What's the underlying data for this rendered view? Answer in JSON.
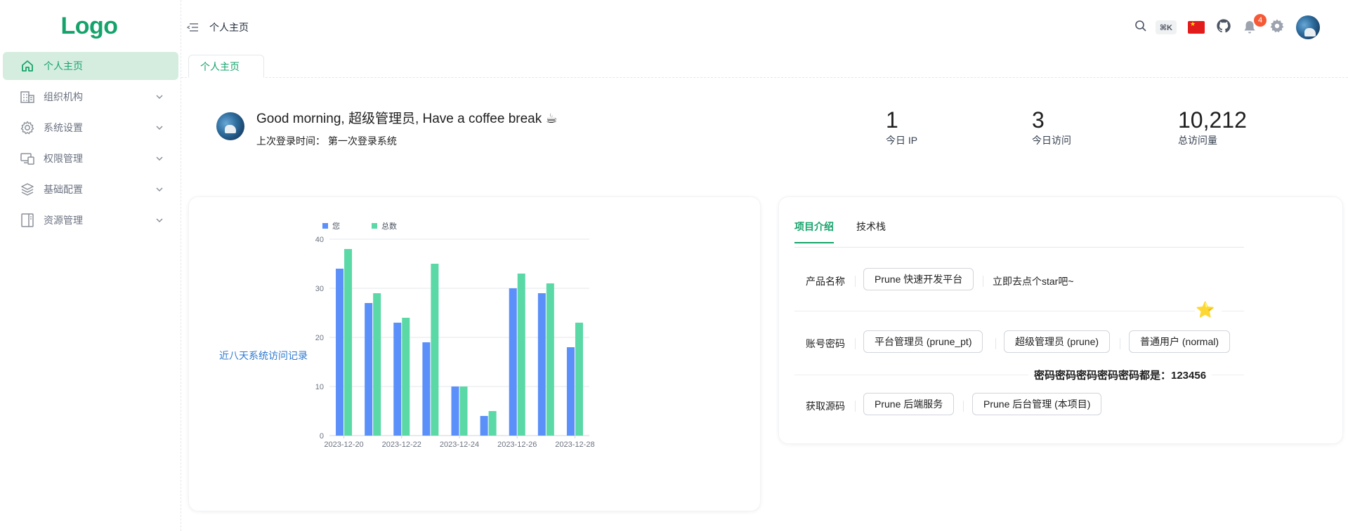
{
  "app": {
    "logo": "Logo"
  },
  "sidebar": {
    "items": [
      {
        "label": "个人主页",
        "icon": "home-icon",
        "active": true
      },
      {
        "label": "组织机构",
        "icon": "building-icon",
        "expandable": true
      },
      {
        "label": "系统设置",
        "icon": "gear-icon",
        "expandable": true
      },
      {
        "label": "权限管理",
        "icon": "monitor-icon",
        "expandable": true
      },
      {
        "label": "基础配置",
        "icon": "layers-icon",
        "expandable": true
      },
      {
        "label": "资源管理",
        "icon": "book-icon",
        "expandable": true
      }
    ]
  },
  "header": {
    "breadcrumb": "个人主页",
    "search_shortcut": "⌘K",
    "notification_count": "4",
    "language_flag": "china-flag-icon"
  },
  "tabs": [
    {
      "label": "个人主页"
    }
  ],
  "welcome": {
    "greeting": "Good morning, 超级管理员, Have a coffee break ☕",
    "last_login_label": "上次登录时间：",
    "last_login_value": "第一次登录系统"
  },
  "stats": [
    {
      "value": "1",
      "label": "今日 IP"
    },
    {
      "value": "3",
      "label": "今日访问"
    },
    {
      "value": "10,212",
      "label": "总访问量"
    }
  ],
  "chart_card": {
    "label": "近八天系统访问记录"
  },
  "chart_data": {
    "type": "bar",
    "categories": [
      "2023-12-20",
      "2023-12-21",
      "2023-12-22",
      "2023-12-23",
      "2023-12-24",
      "2023-12-25",
      "2023-12-26",
      "2023-12-27",
      "2023-12-28"
    ],
    "tick_labels": [
      "2023-12-20",
      "2023-12-22",
      "2023-12-24",
      "2023-12-26",
      "2023-12-28"
    ],
    "series": [
      {
        "name": "您",
        "color": "#5b8ff9",
        "values": [
          34,
          27,
          23,
          19,
          10,
          4,
          30,
          29,
          18
        ]
      },
      {
        "name": "总数",
        "color": "#5ad8a6",
        "values": [
          38,
          29,
          24,
          35,
          10,
          5,
          33,
          31,
          23
        ]
      }
    ],
    "ylim": [
      0,
      40
    ],
    "yticks": [
      0,
      10,
      20,
      30,
      40
    ],
    "legend": "top-left",
    "grid": true
  },
  "intro": {
    "tabs": [
      "项目介绍",
      "技术栈"
    ],
    "rows": {
      "product": {
        "label": "产品名称",
        "button": "Prune 快速开发平台",
        "link": "立即去点个star吧~"
      },
      "account": {
        "label": "账号密码",
        "buttons": [
          "平台管理员 (prune_pt)",
          "超级管理员 (prune)",
          "普通用户 (normal)"
        ],
        "note": "密码密码密码密码密码都是：123456"
      },
      "source": {
        "label": "获取源码",
        "buttons": [
          "Prune 后端服务",
          "Prune 后台管理 (本项目)"
        ]
      }
    },
    "star_icon": "star-icon"
  },
  "colors": {
    "accent": "#16a36b",
    "active_bg": "#d5eddf",
    "link": "#2f7ad0",
    "badge": "#f55936"
  }
}
